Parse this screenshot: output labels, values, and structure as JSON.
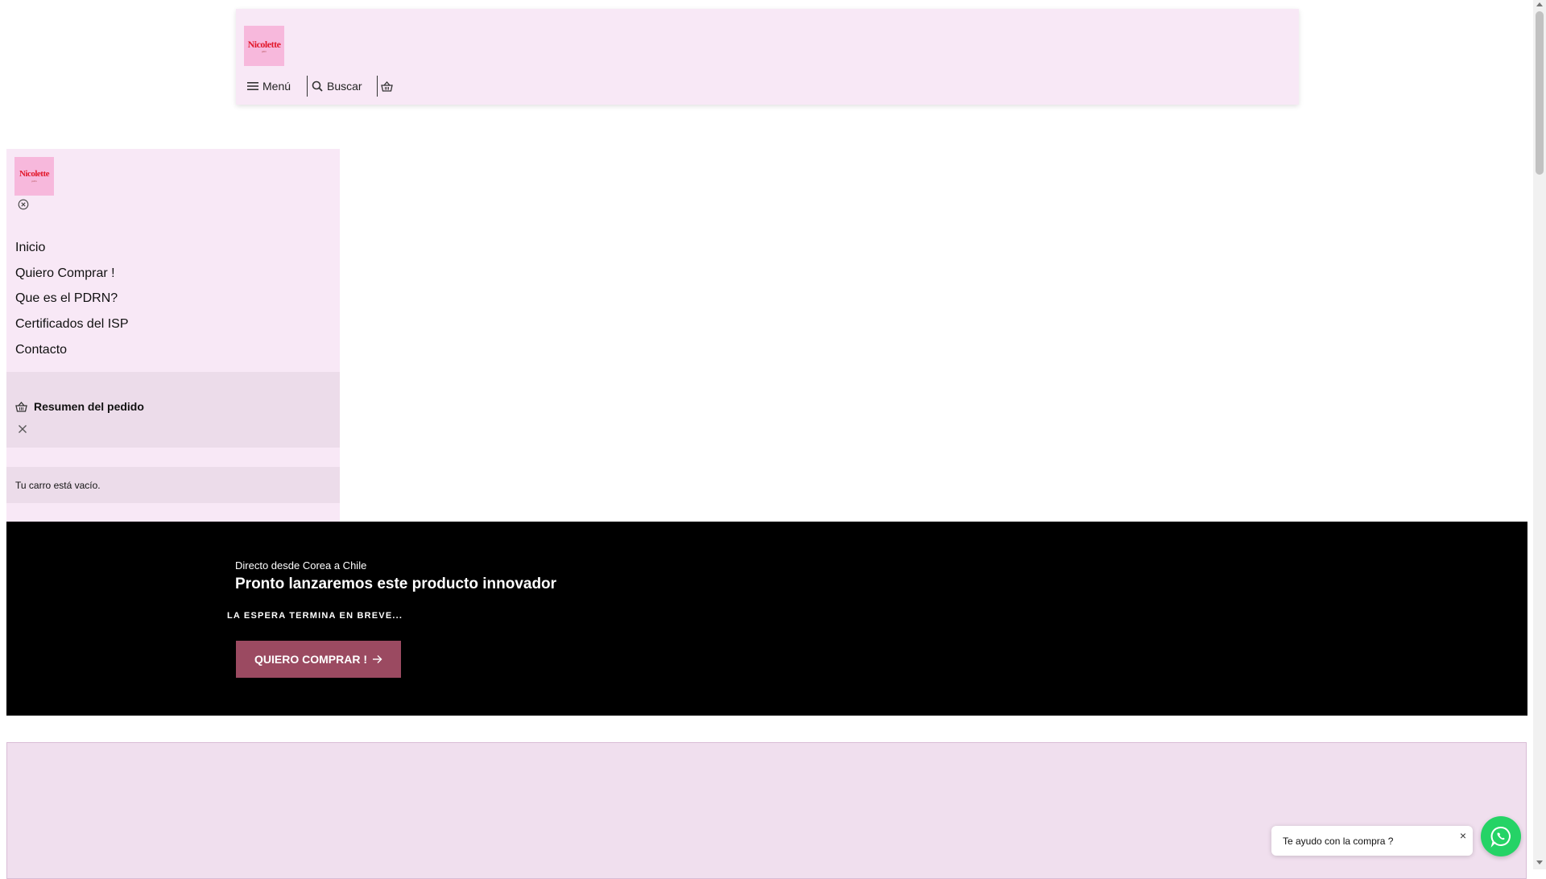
{
  "header": {
    "logo": {
      "brand": "Nicolette",
      "sub": "pdrn"
    },
    "menu_label": "Menú",
    "search_label": "Buscar",
    "icons": {
      "menu": "hamburger-icon",
      "search": "search-icon",
      "cart": "basket-icon"
    }
  },
  "panel": {
    "logo": {
      "brand": "Nicolette",
      "sub": "pdrn"
    },
    "close_icon": "circle-x-icon",
    "menu": [
      {
        "label": "Inicio"
      },
      {
        "label": "Quiero Comprar !"
      },
      {
        "label": "Que es el PDRN?"
      },
      {
        "label": "Certificados del ISP"
      },
      {
        "label": "Contacto"
      }
    ],
    "cart": {
      "title": "Resumen del pedido",
      "empty": "Tu carro está vacío.",
      "close_icon": "close-icon"
    }
  },
  "hero": {
    "eyebrow": "Directo desde Corea a Chile",
    "title": "Pronto lanzaremos este producto innovador",
    "kicker": "LA ESPERA TERMINA EN BREVE...",
    "cta_label": "QUIERO COMPRAR !",
    "cta_icon": "arrow-right-icon"
  },
  "chat": {
    "bubble_text": "Te ayudo con la compra ?",
    "close_label": "×",
    "icon": "whatsapp-icon"
  },
  "colors": {
    "header_bg": "#f8e8f6",
    "logo_bg": "#f7b8dc",
    "cart_bg": "#ecdcea",
    "hero_bg": "#000000",
    "cta_bg": "#9b4a61",
    "whatsapp": "#25d366"
  }
}
